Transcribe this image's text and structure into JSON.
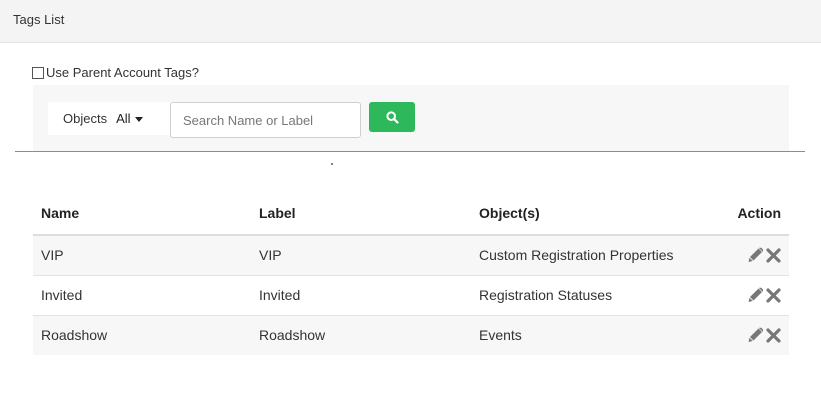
{
  "header": {
    "title": "Tags List"
  },
  "parent_tags": {
    "label": "Use Parent Account Tags?",
    "checked": false
  },
  "filter": {
    "objects_label": "Objects",
    "objects_value": "All",
    "search_placeholder": "Search Name or Label",
    "search_button_icon": "search-icon",
    "accent_color": "#2eb85c"
  },
  "table": {
    "columns": [
      "Name",
      "Label",
      "Object(s)",
      "Action"
    ],
    "rows": [
      {
        "name": "VIP",
        "label": "VIP",
        "objects": "Custom Registration Properties",
        "actions": [
          "pencil-icon",
          "x-icon"
        ]
      },
      {
        "name": "Invited",
        "label": "Invited",
        "objects": "Registration Statuses",
        "actions": [
          "pencil-icon",
          "x-icon"
        ]
      },
      {
        "name": "Roadshow",
        "label": "Roadshow",
        "objects": "Events",
        "actions": [
          "pencil-icon",
          "x-icon"
        ]
      }
    ]
  }
}
